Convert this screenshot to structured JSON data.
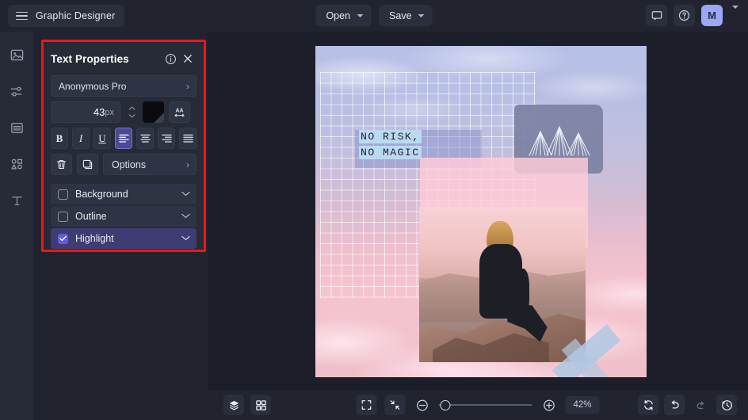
{
  "app": {
    "title": "Graphic Designer",
    "menu_icon": "hamburger-icon"
  },
  "topbar": {
    "open_label": "Open",
    "save_label": "Save",
    "comment_icon": "comment-icon",
    "help_icon": "help-circle-icon",
    "avatar_initial": "M"
  },
  "rail": {
    "items": [
      {
        "icon": "image-icon",
        "name": "sidebar-item-images"
      },
      {
        "icon": "sliders-icon",
        "name": "sidebar-item-adjustments"
      },
      {
        "icon": "layers-lines-icon",
        "name": "sidebar-item-templates"
      },
      {
        "icon": "shapes-icon",
        "name": "sidebar-item-shapes"
      },
      {
        "icon": "text-icon",
        "name": "sidebar-item-text"
      }
    ]
  },
  "panel": {
    "title": "Text Properties",
    "info_icon": "info-circle-icon",
    "close_icon": "close-icon",
    "font_family": "Anonymous Pro",
    "font_size_value": "43",
    "font_size_unit": "px",
    "color_swatch": "#0b0b0f",
    "spacing_icon": "letter-spacing-icon",
    "format": {
      "bold": "B",
      "italic": "I",
      "underline": "U",
      "align_left": "align-left-icon",
      "align_center": "align-center-icon",
      "align_right": "align-right-icon",
      "align_justify": "align-justify-icon",
      "active_align": "align-left"
    },
    "delete_icon": "trash-icon",
    "duplicate_icon": "duplicate-icon",
    "options_label": "Options",
    "toggles": [
      {
        "label": "Background",
        "checked": false
      },
      {
        "label": "Outline",
        "checked": false
      },
      {
        "label": "Highlight",
        "checked": true
      }
    ],
    "highlight_color": "#f41414"
  },
  "canvas": {
    "artwork_text_line1": "NO RISK,",
    "artwork_text_line2": "NO MAGIC",
    "highlight_color": "#bcd9f2"
  },
  "bottombar": {
    "layers_icon": "layers-icon",
    "grid_icon": "grid-icon",
    "fit_icon": "fit-screen-icon",
    "shrink_icon": "shrink-icon",
    "zoom_out_icon": "zoom-out-icon",
    "zoom_in_icon": "zoom-in-icon",
    "zoom_level": "42%",
    "sync_icon": "sync-icon",
    "undo_icon": "undo-icon",
    "redo_icon": "redo-icon",
    "history_icon": "history-icon"
  }
}
